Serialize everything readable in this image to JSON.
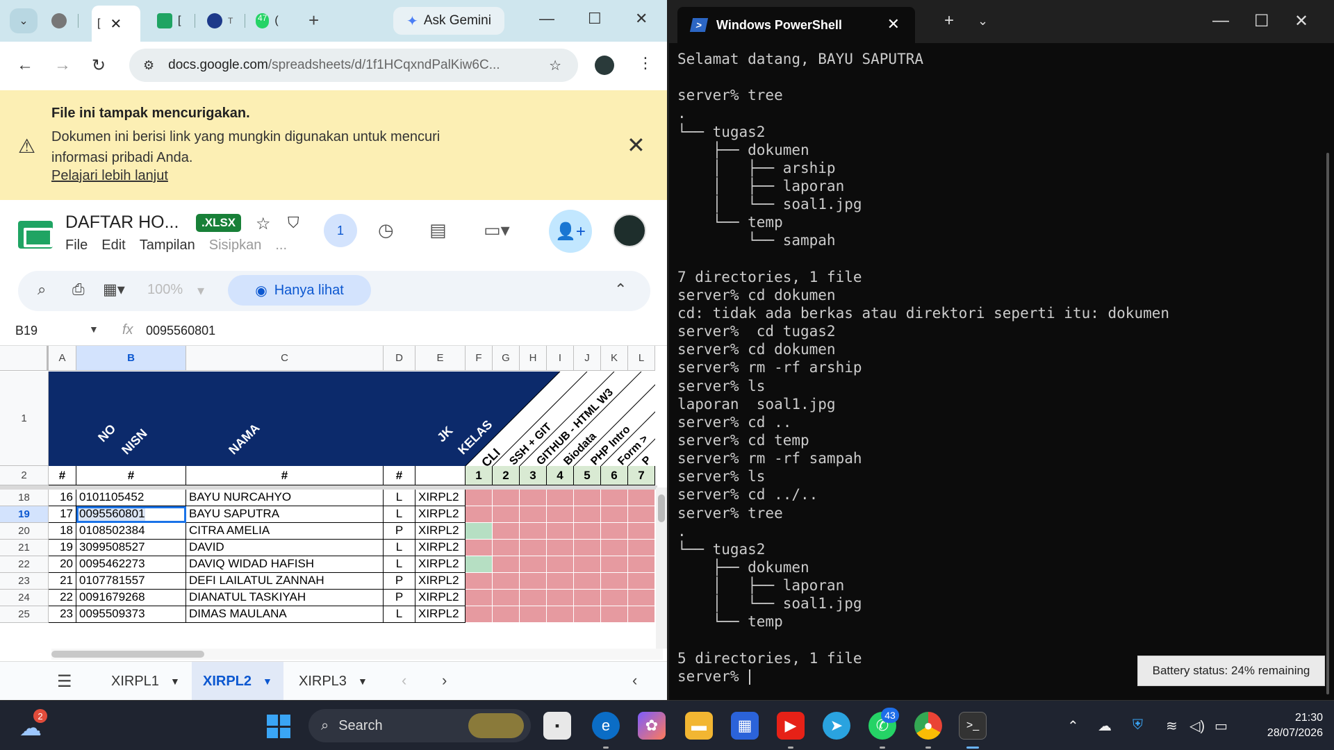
{
  "chrome": {
    "tabs": [
      {
        "label": "[",
        "active": true
      },
      {
        "label": "["
      },
      {
        "label": "T"
      },
      {
        "label": "47 ("
      }
    ],
    "ask_gemini": "Ask Gemini",
    "url_host": "docs.google.com",
    "url_path": "/spreadsheets/d/1f1HCqxndPalKiw6C..."
  },
  "warning": {
    "title": "File ini tampak mencurigakan.",
    "body": "Dokumen ini berisi link yang mungkin digunakan untuk mencuri informasi pribadi Anda.",
    "link": "Pelajari lebih lanjut"
  },
  "docs": {
    "title": "DAFTAR HO...",
    "badge": ".XLSX",
    "menu": [
      "File",
      "Edit",
      "Tampilan",
      "Sisipkan",
      "..."
    ],
    "collab_count": "1",
    "zoom": "100%",
    "view_only": "Hanya lihat",
    "name_box": "B19",
    "formula": "0095560801"
  },
  "sheet": {
    "columns": [
      "A",
      "B",
      "C",
      "D",
      "E",
      "F",
      "G",
      "H",
      "I",
      "J",
      "K",
      "L"
    ],
    "header_row1": {
      "no": "NO",
      "nisn": "NISN",
      "nama": "NAMA",
      "jk": "JK",
      "kelas": "KELAS",
      "tasks": [
        "CLI",
        "SSH + GIT",
        "GITHUB - HTML W3",
        "Biodata",
        "PHP Intro",
        "Form >",
        "P"
      ]
    },
    "header_row2": {
      "hash": "#",
      "nums": [
        "1",
        "2",
        "3",
        "4",
        "5",
        "6",
        "7"
      ]
    },
    "row_numbers": [
      "1",
      "2",
      "18",
      "19",
      "20",
      "21",
      "22",
      "23",
      "24",
      "25"
    ],
    "rows": [
      {
        "no": "16",
        "nisn": "0101105452",
        "nama": "BAYU NURCAHYO",
        "jk": "L",
        "kelas": "XIRPL2",
        "done": [
          false,
          false,
          false,
          false,
          false,
          false,
          false
        ]
      },
      {
        "no": "17",
        "nisn": "0095560801",
        "nama": "BAYU SAPUTRA",
        "jk": "L",
        "kelas": "XIRPL2",
        "done": [
          false,
          false,
          false,
          false,
          false,
          false,
          false
        ]
      },
      {
        "no": "18",
        "nisn": "0108502384",
        "nama": "CITRA AMELIA",
        "jk": "P",
        "kelas": "XIRPL2",
        "done": [
          true,
          false,
          false,
          false,
          false,
          false,
          false
        ]
      },
      {
        "no": "19",
        "nisn": "3099508527",
        "nama": "DAVID",
        "jk": "L",
        "kelas": "XIRPL2",
        "done": [
          false,
          false,
          false,
          false,
          false,
          false,
          false
        ]
      },
      {
        "no": "20",
        "nisn": "0095462273",
        "nama": "DAVIQ WIDAD HAFISH",
        "jk": "L",
        "kelas": "XIRPL2",
        "done": [
          true,
          false,
          false,
          false,
          false,
          false,
          false
        ]
      },
      {
        "no": "21",
        "nisn": "0107781557",
        "nama": "DEFI LAILATUL ZANNAH",
        "jk": "P",
        "kelas": "XIRPL2",
        "done": [
          false,
          false,
          false,
          false,
          false,
          false,
          false
        ]
      },
      {
        "no": "22",
        "nisn": "0091679268",
        "nama": "DIANATUL TASKIYAH",
        "jk": "P",
        "kelas": "XIRPL2",
        "done": [
          false,
          false,
          false,
          false,
          false,
          false,
          false
        ]
      },
      {
        "no": "23",
        "nisn": "0095509373",
        "nama": "DIMAS MAULANA",
        "jk": "L",
        "kelas": "XIRPL2",
        "done": [
          false,
          false,
          false,
          false,
          false,
          false,
          false
        ]
      }
    ],
    "sheet_tabs": [
      "XIRPL1",
      "XIRPL2",
      "XIRPL3"
    ],
    "active_tab": "XIRPL2",
    "colors": {
      "navy": "#0c2a6b",
      "pink": "#e69aa0",
      "green": "#b6dfc3"
    }
  },
  "powershell": {
    "title": "Windows PowerShell",
    "lines": [
      "Selamat datang, BAYU SAPUTRA",
      "",
      "server% tree",
      ".",
      "└── tugas2",
      "    ├── dokumen",
      "    │   ├── arship",
      "    │   ├── laporan",
      "    │   └── soal1.jpg",
      "    └── temp",
      "        └── sampah",
      "",
      "7 directories, 1 file",
      "server% cd dokumen",
      "cd: tidak ada berkas atau direktori seperti itu: dokumen",
      "server%  cd tugas2",
      "server% cd dokumen",
      "server% rm -rf arship",
      "server% ls",
      "laporan  soal1.jpg",
      "server% cd ..",
      "server% cd temp",
      "server% rm -rf sampah",
      "server% ls",
      "server% cd ../..",
      "server% tree",
      ".",
      "└── tugas2",
      "    ├── dokumen",
      "    │   ├── laporan",
      "    │   └── soal1.jpg",
      "    └── temp",
      "",
      "5 directories, 1 file"
    ],
    "prompt": "server% "
  },
  "toast": "Battery status: 24% remaining",
  "taskbar": {
    "weather_badge": "2",
    "search_placeholder": "Search",
    "whatsapp_badge": "43",
    "time": "21:30",
    "date": "28/07/2026"
  }
}
